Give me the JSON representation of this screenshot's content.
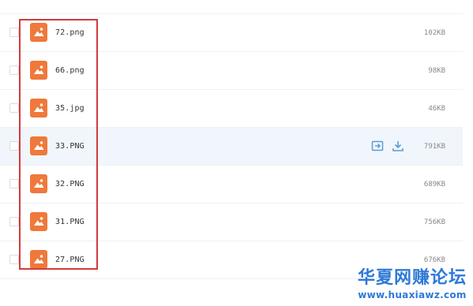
{
  "files": [
    {
      "name": "72.png",
      "size": "102KB"
    },
    {
      "name": "66.png",
      "size": "98KB"
    },
    {
      "name": "35.jpg",
      "size": "46KB"
    },
    {
      "name": "33.PNG",
      "size": "791KB"
    },
    {
      "name": "32.PNG",
      "size": "689KB"
    },
    {
      "name": "31.PNG",
      "size": "756KB"
    },
    {
      "name": "27.PNG",
      "size": "676KB"
    }
  ],
  "hovered_row_index": 3,
  "icons": {
    "file_type": "image-file-icon",
    "row_actions": [
      "share-icon",
      "download-icon"
    ]
  },
  "colors": {
    "file_icon": "#f0783b",
    "hover_row": "#f1f6fc",
    "action_icon": "#5b9bd5",
    "highlight_border": "#d23b3b",
    "watermark": "#2f79d8"
  },
  "watermark": {
    "title": "华夏网赚论坛",
    "url": "www.huaxiawz.com"
  }
}
